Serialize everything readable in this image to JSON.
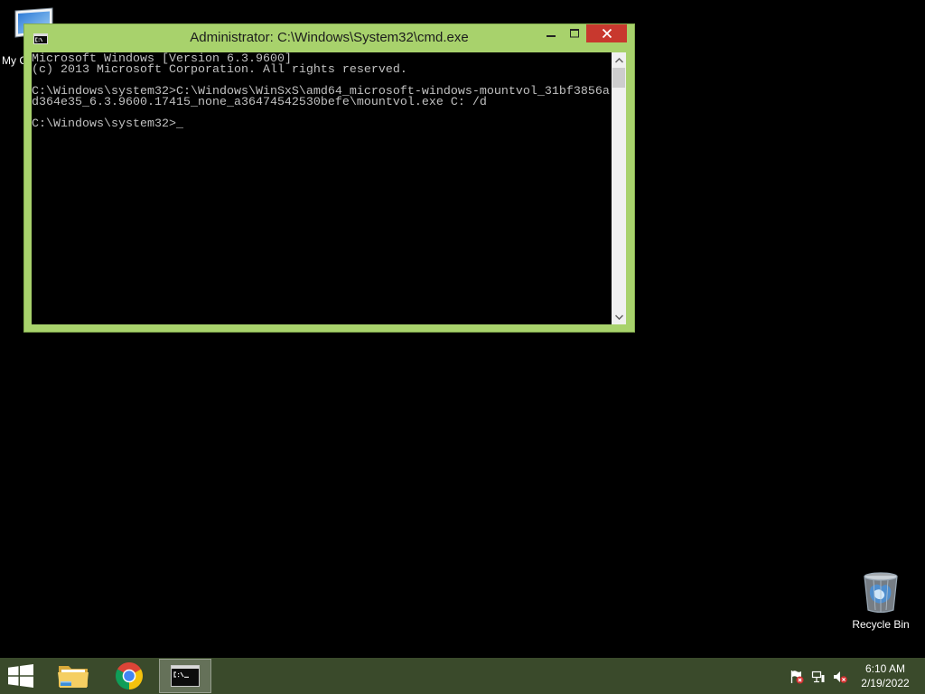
{
  "desktop": {
    "background": "#000000",
    "computer": {
      "label": "My C",
      "icon": "computer-icon"
    },
    "recycle_bin": {
      "label": "Recycle Bin",
      "icon": "recycle-bin-icon"
    }
  },
  "window": {
    "title": "Administrator: C:\\Windows\\System32\\cmd.exe",
    "app_icon": "cmd-icon",
    "frame_color": "#a8d26c",
    "buttons": {
      "minimize_icon": "minimize-icon",
      "maximize_icon": "maximize-icon",
      "close_icon": "close-icon",
      "close_color": "#c8382e"
    },
    "console": {
      "background": "#000000",
      "text_color": "#c0c0c0",
      "lines": [
        "Microsoft Windows [Version 6.3.9600]",
        "(c) 2013 Microsoft Corporation. All rights reserved.",
        "",
        "C:\\Windows\\system32>C:\\Windows\\WinSxS\\amd64_microsoft-windows-mountvol_31bf3856a",
        "d364e35_6.3.9600.17415_none_a36474542530befe\\mountvol.exe C: /d",
        ""
      ],
      "prompt": "C:\\Windows\\system32>",
      "cursor": "_"
    },
    "scrollbar": {
      "up_icon": "scroll-up-icon",
      "down_icon": "scroll-down-icon",
      "scroll_position": 0
    }
  },
  "taskbar": {
    "color": "#3a4a2b",
    "start_icon": "windows-logo-icon",
    "apps": [
      {
        "icon": "file-explorer-icon",
        "active": false
      },
      {
        "icon": "chrome-icon",
        "active": false
      },
      {
        "icon": "cmd-icon",
        "active": true
      }
    ],
    "tray": {
      "icons": [
        "action-center-flag-icon",
        "network-icon",
        "volume-muted-icon"
      ],
      "time": "6:10 AM",
      "date": "2/19/2022"
    }
  }
}
